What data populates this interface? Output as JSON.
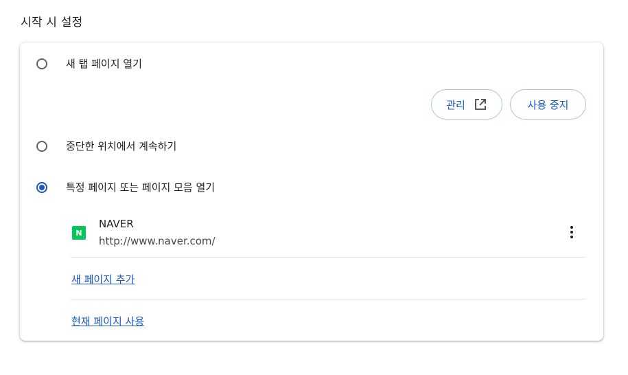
{
  "section_title": "시작 시 설정",
  "options": {
    "new_tab": "새 탭 페이지 열기",
    "continue": "중단한 위치에서 계속하기",
    "specific_pages": "특정 페이지 또는 페이지 모음 열기"
  },
  "selected_option": "specific_pages",
  "extension_controls": {
    "manage_label": "관리",
    "disable_label": "사용 중지"
  },
  "pages": [
    {
      "name": "NAVER",
      "url": "http://www.naver.com/",
      "favicon_letter": "N",
      "favicon_color": "#03c75a"
    }
  ],
  "links": {
    "add_page": "새 페이지 추가",
    "use_current": "현재 페이지 사용"
  },
  "colors": {
    "accent": "#1a56c4",
    "text": "#1f1f1f"
  }
}
